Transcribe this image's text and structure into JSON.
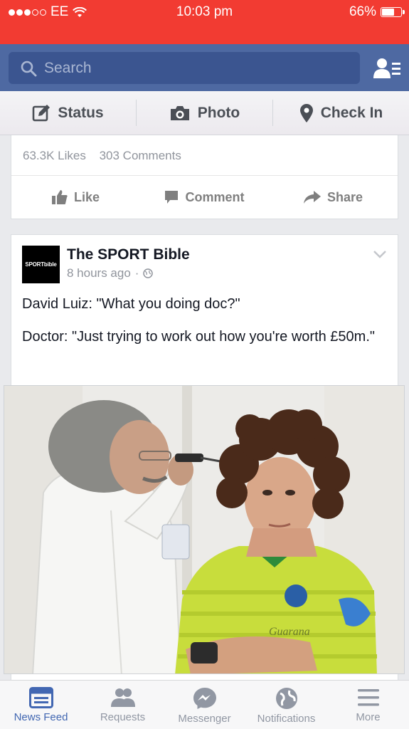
{
  "status_bar": {
    "carrier": "EE",
    "time": "10:03 pm",
    "battery_percent": "66%",
    "battery_level": 0.66,
    "signal_dots_filled": 3,
    "signal_dots_total": 5
  },
  "nav": {
    "search_placeholder": "Search"
  },
  "publisher": {
    "status_label": "Status",
    "photo_label": "Photo",
    "checkin_label": "Check In"
  },
  "prev_post": {
    "likes": "63.3K Likes",
    "comments": "303 Comments",
    "like_label": "Like",
    "comment_label": "Comment",
    "share_label": "Share"
  },
  "post": {
    "page_logo_text": "SPORTbible",
    "page_name": "The SPORT Bible",
    "time_ago": "8 hours ago",
    "separator": "·",
    "text_line1": "David Luiz: \"What you doing doc?\"",
    "text_line2": "Doctor: \"Just trying to work out how you're worth £50m.\"",
    "jersey_sponsor_text": "Guarana"
  },
  "tabs": [
    {
      "label": "News Feed",
      "icon": "news-feed-icon",
      "active": true
    },
    {
      "label": "Requests",
      "icon": "friend-requests-icon",
      "active": false
    },
    {
      "label": "Messenger",
      "icon": "messenger-icon",
      "active": false
    },
    {
      "label": "Notifications",
      "icon": "globe-icon",
      "active": false
    },
    {
      "label": "More",
      "icon": "menu-icon",
      "active": false
    }
  ],
  "colors": {
    "status_bar": "#f23b32",
    "nav_bar": "#4e69a2",
    "search_field": "#3b5590",
    "active_tab": "#4267b2",
    "inactive": "#9197a3"
  }
}
